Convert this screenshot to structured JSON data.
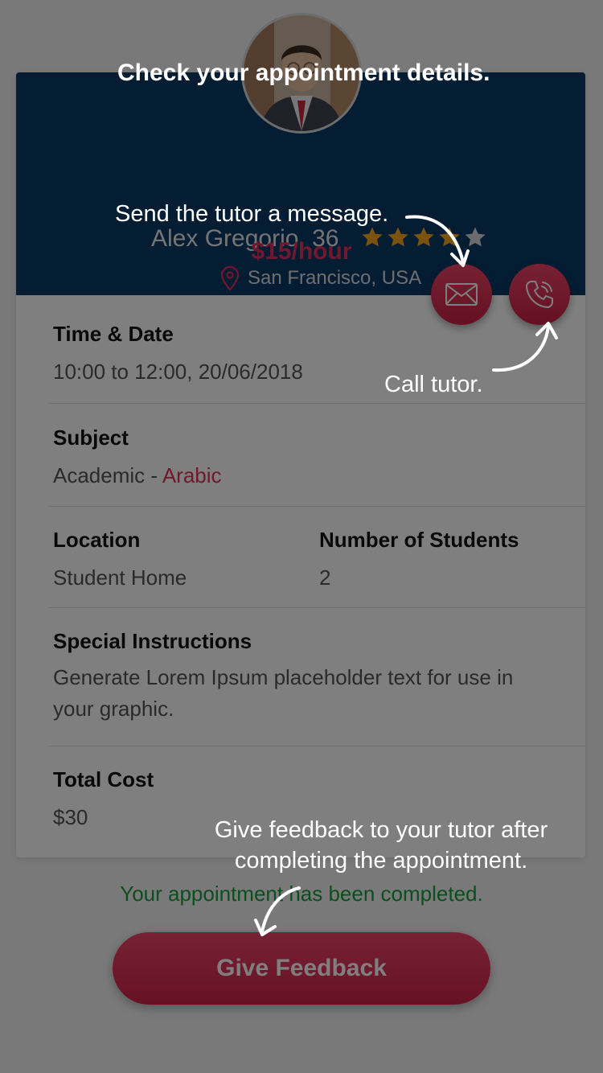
{
  "tutor": {
    "name": "Alex Gregorio, 36",
    "rating": 4,
    "rating_max": 5,
    "location": "San Francisco, USA",
    "rate": "$15/hour"
  },
  "details": {
    "time_date": {
      "label": "Time & Date",
      "value": "10:00 to 12:00, 20/06/2018"
    },
    "subject": {
      "label": "Subject",
      "category": "Academic - ",
      "name": "Arabic"
    },
    "location": {
      "label": "Location",
      "value": "Student Home"
    },
    "students": {
      "label": "Number of Students",
      "value": "2"
    },
    "instructions": {
      "label": "Special Instructions",
      "line1": "Generate Lorem Ipsum placeholder text for use in",
      "line2": "your graphic."
    },
    "total_cost": {
      "label": "Total Cost",
      "value": "$30"
    }
  },
  "status": "Your appointment has been completed.",
  "feedback_button": "Give Feedback",
  "hints": {
    "title": "Check your appointment details.",
    "message": "Send the tutor a message.",
    "call": "Call tutor.",
    "feedback_line1": "Give feedback to your tutor after",
    "feedback_line2": "completing the appointment."
  },
  "icons": [
    "mail-icon",
    "phone-icon",
    "location-pin-icon",
    "star-icon"
  ],
  "colors": {
    "header": "#0a3a66",
    "accent": "#e0305a",
    "success": "#1a9d3c",
    "star": "#f5a623"
  }
}
